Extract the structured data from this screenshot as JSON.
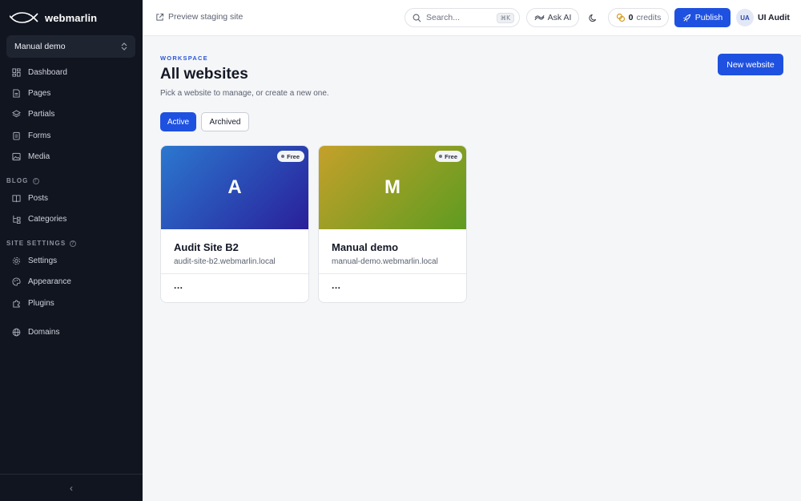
{
  "sidebar": {
    "brand": "webmarlin",
    "site_selector": "Manual demo",
    "items_main": [
      {
        "label": "Dashboard",
        "icon": "dashboard-icon"
      },
      {
        "label": "Pages",
        "icon": "page-icon"
      },
      {
        "label": "Partials",
        "icon": "layers-icon"
      },
      {
        "label": "Forms",
        "icon": "form-icon"
      },
      {
        "label": "Media",
        "icon": "image-icon"
      }
    ],
    "blog_label": "BLOG",
    "items_blog": [
      {
        "label": "Posts",
        "icon": "book-icon"
      },
      {
        "label": "Categories",
        "icon": "tree-icon"
      }
    ],
    "settings_label": "SITE SETTINGS",
    "items_settings": [
      {
        "label": "Settings",
        "icon": "gear-icon"
      },
      {
        "label": "Appearance",
        "icon": "palette-icon"
      },
      {
        "label": "Plugins",
        "icon": "puzzle-icon"
      }
    ],
    "domains": {
      "label": "Domains",
      "icon": "globe-icon"
    },
    "collapse_glyph": "‹"
  },
  "topbar": {
    "preview_label": "Preview staging site",
    "search_placeholder": "Search...",
    "search_shortcut": "⌘K",
    "ask_ai": "Ask AI",
    "credits_count": "0",
    "credits_label": "credits",
    "publish": "Publish",
    "avatar_initials": "UA",
    "user_name": "UI Audit"
  },
  "main": {
    "eyebrow": "WORKSPACE",
    "title": "All websites",
    "subtitle": "Pick a website to manage, or create a new one.",
    "new_button": "New website",
    "tabs": [
      {
        "label": "Active",
        "selected": true
      },
      {
        "label": "Archived",
        "selected": false
      }
    ],
    "websites": [
      {
        "initial": "A",
        "name": "Audit Site B2",
        "url": "audit-site-b2.webmarlin.local",
        "badge": "Free",
        "more": "...",
        "gradient": [
          "#2b78cf",
          "#2a1f9a"
        ]
      },
      {
        "initial": "M",
        "name": "Manual demo",
        "url": "manual-demo.webmarlin.local",
        "badge": "Free",
        "more": "...",
        "gradient": [
          "#c4a02a",
          "#5e9c20"
        ]
      }
    ]
  },
  "colors": {
    "sidebar_bg": "#111520",
    "accent": "#1f51e0",
    "page_bg": "#f5f6f8"
  }
}
